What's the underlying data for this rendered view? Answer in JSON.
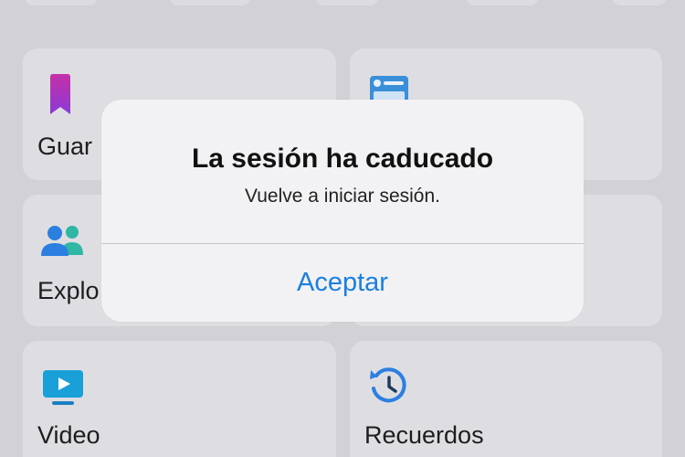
{
  "cards": [
    {
      "label": "Guar",
      "icon": "bookmark-icon"
    },
    {
      "label": "",
      "icon": "id-card-icon"
    },
    {
      "label": "Explo",
      "icon": "people-icon"
    },
    {
      "label": "",
      "icon": ""
    },
    {
      "label": "Video",
      "icon": "video-icon"
    },
    {
      "label": "Recuerdos",
      "icon": "clock-history-icon"
    }
  ],
  "alert": {
    "title": "La sesión ha caducado",
    "message": "Vuelve a iniciar sesión.",
    "button_label": "Aceptar"
  },
  "colors": {
    "accent": "#1b7fe0",
    "background": "#d2d2d6",
    "card": "#dedee2",
    "alert": "#f2f2f4"
  }
}
